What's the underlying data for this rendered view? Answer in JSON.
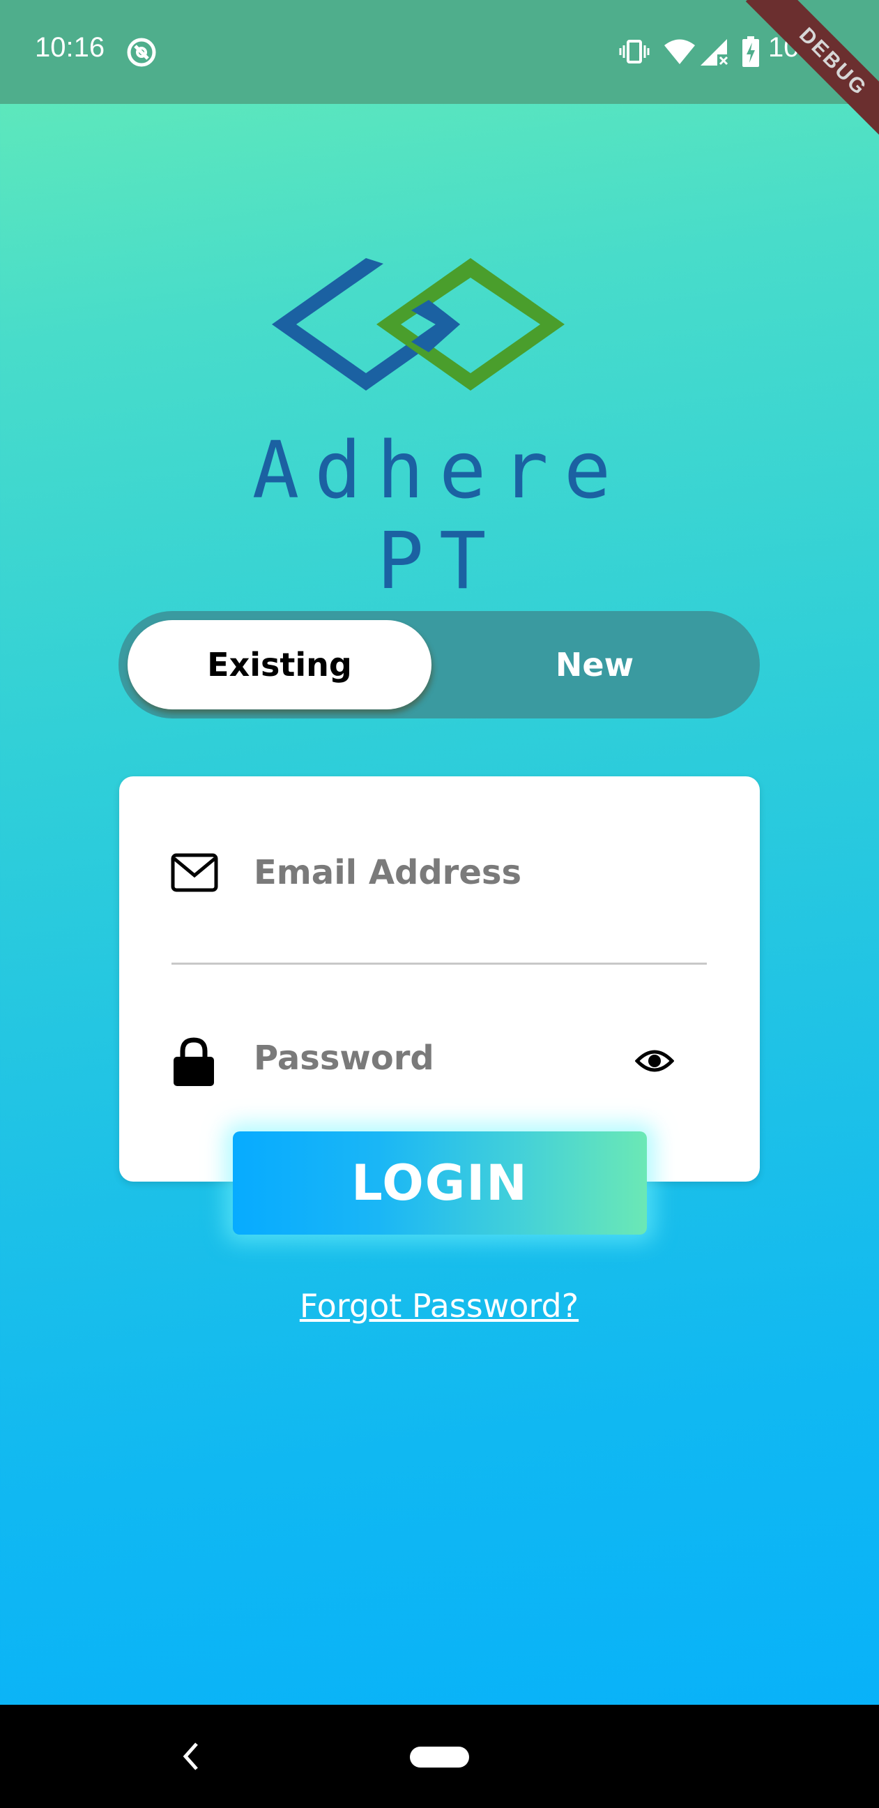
{
  "status_bar": {
    "time": "10:16",
    "battery": "100%",
    "icons": [
      "do-not-disturb-icon",
      "vibrate-icon",
      "wifi-icon",
      "signal-icon",
      "battery-charging-icon"
    ]
  },
  "debug_banner": "DEBUG",
  "logo": {
    "text": "Adhere PT",
    "colors": {
      "blue": "#1b61a2",
      "green": "#4a9e2c"
    }
  },
  "auth_toggle": {
    "existing_label": "Existing",
    "new_label": "New",
    "selected": "Existing"
  },
  "form": {
    "email_placeholder": "Email Address",
    "password_placeholder": "Password",
    "login_label": "LOGIN",
    "forgot_label": "Forgot Password?"
  },
  "nav_bar": {
    "icons": [
      "back-icon",
      "home-pill"
    ]
  },
  "colors": {
    "status_bar": "#4fae8c",
    "gradient_top": "#66ecb6",
    "gradient_bottom": "#06b0fb",
    "toggle_track": "#3a9aa0",
    "placeholder": "#7a7a7a"
  }
}
